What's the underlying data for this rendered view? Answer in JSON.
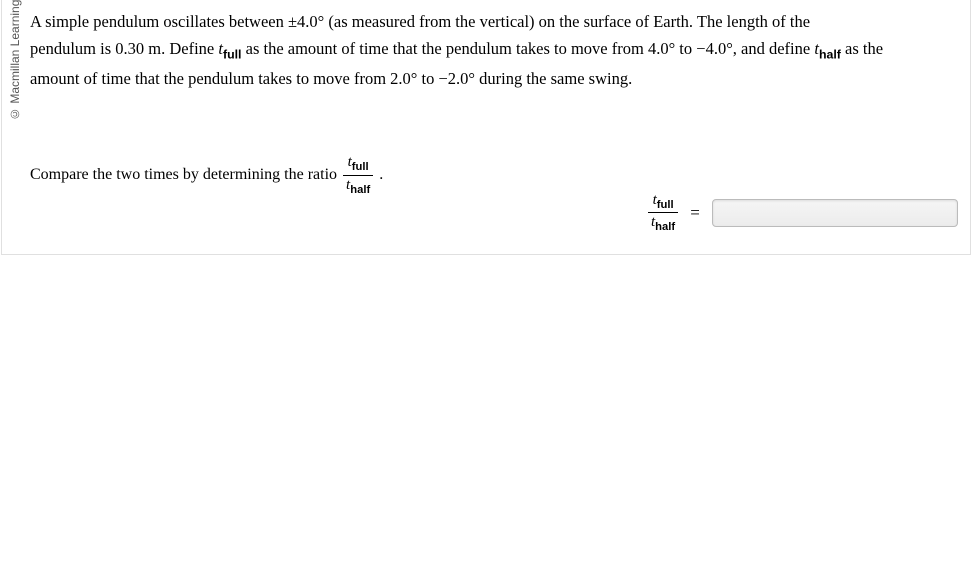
{
  "copyright": "© Macmillan Learning",
  "problem": {
    "line1_a": "A simple pendulum oscillates between ±4.0° (as measured from the vertical) on the surface of Earth. The length of the",
    "line2_a": "pendulum is 0.30 m. Define ",
    "tvar": "t",
    "sub_full": "full",
    "line2_b": " as the amount of time that the pendulum takes to move from 4.0° to −4.0°, and define ",
    "sub_half": "half",
    "line2_c": " as the",
    "line3_a": "amount of time that the pendulum takes to move from 2.0° to −2.0° during the same swing."
  },
  "prompt": {
    "text": "Compare the two times by determining the ratio ",
    "period": "."
  },
  "equals": "=",
  "answer_value": ""
}
